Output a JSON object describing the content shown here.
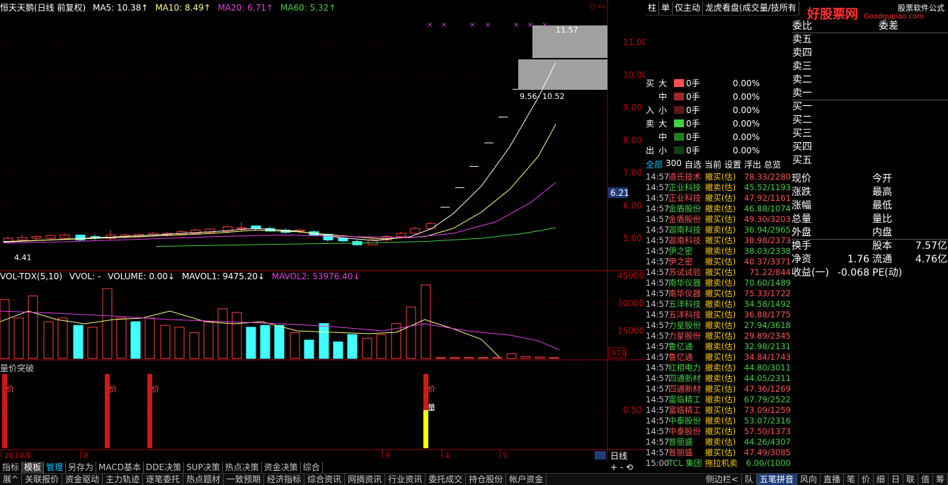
{
  "chart_legend": {
    "title": "恒天天鹅(日线 前复权)",
    "ma5": "MA5: 10.38↑",
    "ma10": "MA10: 8.49↑",
    "ma20": "MA20: 6.71↑",
    "ma60": "MA60: 5.32↑"
  },
  "colors": {
    "ma5": "#ffffff",
    "ma10": "#ffff80",
    "ma20": "#e040e0",
    "ma60": "#40d040",
    "up": "#ff4040",
    "down": "#40ffff",
    "bg": "#000000"
  },
  "price_axis": [
    "11.00",
    "10.00",
    "9.00",
    "8.00",
    "7.00",
    "6.00",
    "5.00"
  ],
  "current_price": "6.21",
  "annotations": {
    "high": "11.57",
    "low": "4.41",
    "range": "9.56- 10.52"
  },
  "vol_legend": {
    "name": "VOL-TDX(5,10)",
    "vvol": "VVOL: -",
    "volume": "VOLUME: 0.00↓",
    "mavol1": "MAVOL1: 9475.20↓",
    "mavol2": "MAVOL2: 53976.40↓"
  },
  "vol_axis": [
    "45000",
    "30000",
    "15000"
  ],
  "vol_unit": "X10",
  "signal": {
    "title": "量价突破",
    "axis": "0.50",
    "labels": [
      "价",
      "价",
      "价",
      "价",
      "量"
    ]
  },
  "date_axis": [
    "2014年",
    "8",
    "9",
    "4",
    "5"
  ],
  "period": "日线",
  "right_tabs": [
    "柱",
    "单",
    "仅主动",
    "龙虎看盘(成交量/技所有"
  ],
  "flow": [
    {
      "side": "买",
      "sz": "大",
      "qty": "0手",
      "pct": "0.00%",
      "color": "#ff5050"
    },
    {
      "side": "",
      "sz": "中",
      "qty": "0手",
      "pct": "0.00%",
      "color": "#a02828"
    },
    {
      "side": "入",
      "sz": "小",
      "qty": "0手",
      "pct": "0.00%",
      "color": "#601818"
    },
    {
      "side": "卖",
      "sz": "大",
      "qty": "0手",
      "pct": "0.00%",
      "color": "#40d040"
    },
    {
      "side": "",
      "sz": "中",
      "qty": "0手",
      "pct": "0.00%",
      "color": "#208020"
    },
    {
      "side": "出",
      "sz": "小",
      "qty": "0手",
      "pct": "0.00%",
      "color": "#104010"
    }
  ],
  "trade_tabs": [
    "全部",
    "300",
    "自选",
    "当前",
    "设置",
    "浮出",
    "总览"
  ],
  "trades": [
    {
      "t": "14:57",
      "n": "道氏技术",
      "a": "撤买(估)",
      "p": "78.33/2280",
      "c": "#ff5050"
    },
    {
      "t": "14:57",
      "n": "正业科技",
      "a": "撤卖(估)",
      "p": "45.52/1193",
      "c": "#40d040"
    },
    {
      "t": "14:57",
      "n": "正业科技",
      "a": "撤买(估)",
      "p": "47.92/1161",
      "c": "#ff5050"
    },
    {
      "t": "14:57",
      "n": "金盾股份",
      "a": "撤卖(估)",
      "p": "46.88/1074",
      "c": "#40d040"
    },
    {
      "t": "14:57",
      "n": "金盾股份",
      "a": "撤买(估)",
      "p": "49.30/3203",
      "c": "#ff5050"
    },
    {
      "t": "14:57",
      "n": "迦南科技",
      "a": "撤卖(估)",
      "p": "36.94/2965",
      "c": "#40d040"
    },
    {
      "t": "14:57",
      "n": "迦南科技",
      "a": "撤买(估)",
      "p": "38.98/2373",
      "c": "#ff5050"
    },
    {
      "t": "14:57",
      "n": "伊之密",
      "a": "撤卖(估)",
      "p": "38.03/2338",
      "c": "#40d040"
    },
    {
      "t": "14:57",
      "n": "伊之密",
      "a": "撤买(估)",
      "p": "40.37/3371",
      "c": "#ff5050"
    },
    {
      "t": "14:57",
      "n": "苏试试验",
      "a": "撤买(估)",
      "p": "71.22/844",
      "c": "#ff5050"
    },
    {
      "t": "14:57",
      "n": "南华仪器",
      "a": "撤卖(估)",
      "p": "70.60/1489",
      "c": "#40d040"
    },
    {
      "t": "14:57",
      "n": "南华仪器",
      "a": "撤买(估)",
      "p": "75.33/1722",
      "c": "#ff5050"
    },
    {
      "t": "14:57",
      "n": "五洋科技",
      "a": "撤卖(估)",
      "p": "34.58/1492",
      "c": "#40d040"
    },
    {
      "t": "14:57",
      "n": "五洋科技",
      "a": "撤买(估)",
      "p": "36.88/1775",
      "c": "#ff5050"
    },
    {
      "t": "14:57",
      "n": "力星股份",
      "a": "撤卖(估)",
      "p": "27.94/3618",
      "c": "#40d040"
    },
    {
      "t": "14:57",
      "n": "力星股份",
      "a": "撤买(估)",
      "p": "29.89/2345",
      "c": "#ff5050"
    },
    {
      "t": "14:57",
      "n": "鲁亿通",
      "a": "撤卖(估)",
      "p": "32.98/2131",
      "c": "#40d040"
    },
    {
      "t": "14:57",
      "n": "鲁亿通",
      "a": "撤买(估)",
      "p": "34.84/1743",
      "c": "#ff5050"
    },
    {
      "t": "14:57",
      "n": "红相电力",
      "a": "撤卖(估)",
      "p": "44.80/3011",
      "c": "#40d040"
    },
    {
      "t": "14:57",
      "n": "四通新材",
      "a": "撤卖(估)",
      "p": "44.05/2311",
      "c": "#40d040"
    },
    {
      "t": "14:57",
      "n": "四通新材",
      "a": "撤买(估)",
      "p": "47.36/1269",
      "c": "#ff5050"
    },
    {
      "t": "14:57",
      "n": "富临精工",
      "a": "撤卖(估)",
      "p": "67.79/2522",
      "c": "#40d040"
    },
    {
      "t": "14:57",
      "n": "富临精工",
      "a": "撤买(估)",
      "p": "73.09/1259",
      "c": "#ff5050"
    },
    {
      "t": "14:57",
      "n": "中泰股份",
      "a": "撤卖(估)",
      "p": "53.07/2316",
      "c": "#40d040"
    },
    {
      "t": "14:57",
      "n": "中泰股份",
      "a": "撤买(估)",
      "p": "57.50/1373",
      "c": "#ff5050"
    },
    {
      "t": "14:57",
      "n": "普丽盛",
      "a": "撤卖(估)",
      "p": "44.26/4307",
      "c": "#40d040"
    },
    {
      "t": "14:57",
      "n": "普丽盛",
      "a": "撤买(估)",
      "p": "47.49/3085",
      "c": "#ff5050"
    },
    {
      "t": "15:00",
      "n": "TCL 集团",
      "a": "拖拉机卖",
      "p": "6.00/(1000",
      "c": "#40d040"
    }
  ],
  "orderbook": {
    "weibi": "委比",
    "weicha": "委差",
    "rows": [
      "卖五",
      "卖四",
      "卖三",
      "卖二",
      "卖一",
      "买一",
      "买二",
      "买三",
      "买四",
      "买五"
    ]
  },
  "quote": [
    {
      "l1": "现价",
      "v1": "",
      "l2": "今开",
      "v2": ""
    },
    {
      "l1": "涨跌",
      "v1": "",
      "l2": "最高",
      "v2": ""
    },
    {
      "l1": "涨幅",
      "v1": "",
      "l2": "最低",
      "v2": ""
    },
    {
      "l1": "总量",
      "v1": "",
      "l2": "量比",
      "v2": ""
    },
    {
      "l1": "外盘",
      "v1": "",
      "l2": "内盘",
      "v2": ""
    },
    {
      "l1": "换手",
      "v1": "",
      "l2": "股本",
      "v2": "7.57亿"
    },
    {
      "l1": "净资",
      "v1": "1.76",
      "l2": "流通",
      "v2": "4.76亿"
    },
    {
      "l1": "收益(一)",
      "v1": "-0.068",
      "l2": "PE(动)",
      "v2": ""
    }
  ],
  "logo": {
    "main": "好股票网",
    "url": "Goodgupiao.com",
    "top": "股票软件公式"
  },
  "bottom_tabs": [
    "指标",
    "模板",
    "管理",
    "另存为",
    "MACD基本",
    "DDE决策",
    "SUP决策",
    "热点决策",
    "资金决策",
    "综合"
  ],
  "status_bar": [
    "展^",
    "关联报价",
    "资金驱动",
    "主力轨迹",
    "逐笔委托",
    "热点题材",
    "一致预期",
    "经济指标",
    "综合资讯",
    "网摘资讯",
    "行业资讯",
    "委托成交",
    "持仓股份",
    "帐户资金"
  ],
  "status_right": [
    "侧边栏<",
    "队",
    "五笔拼音",
    "风向",
    "直播",
    "笔",
    "价",
    "细",
    "日",
    "联",
    "值",
    "筹"
  ]
}
